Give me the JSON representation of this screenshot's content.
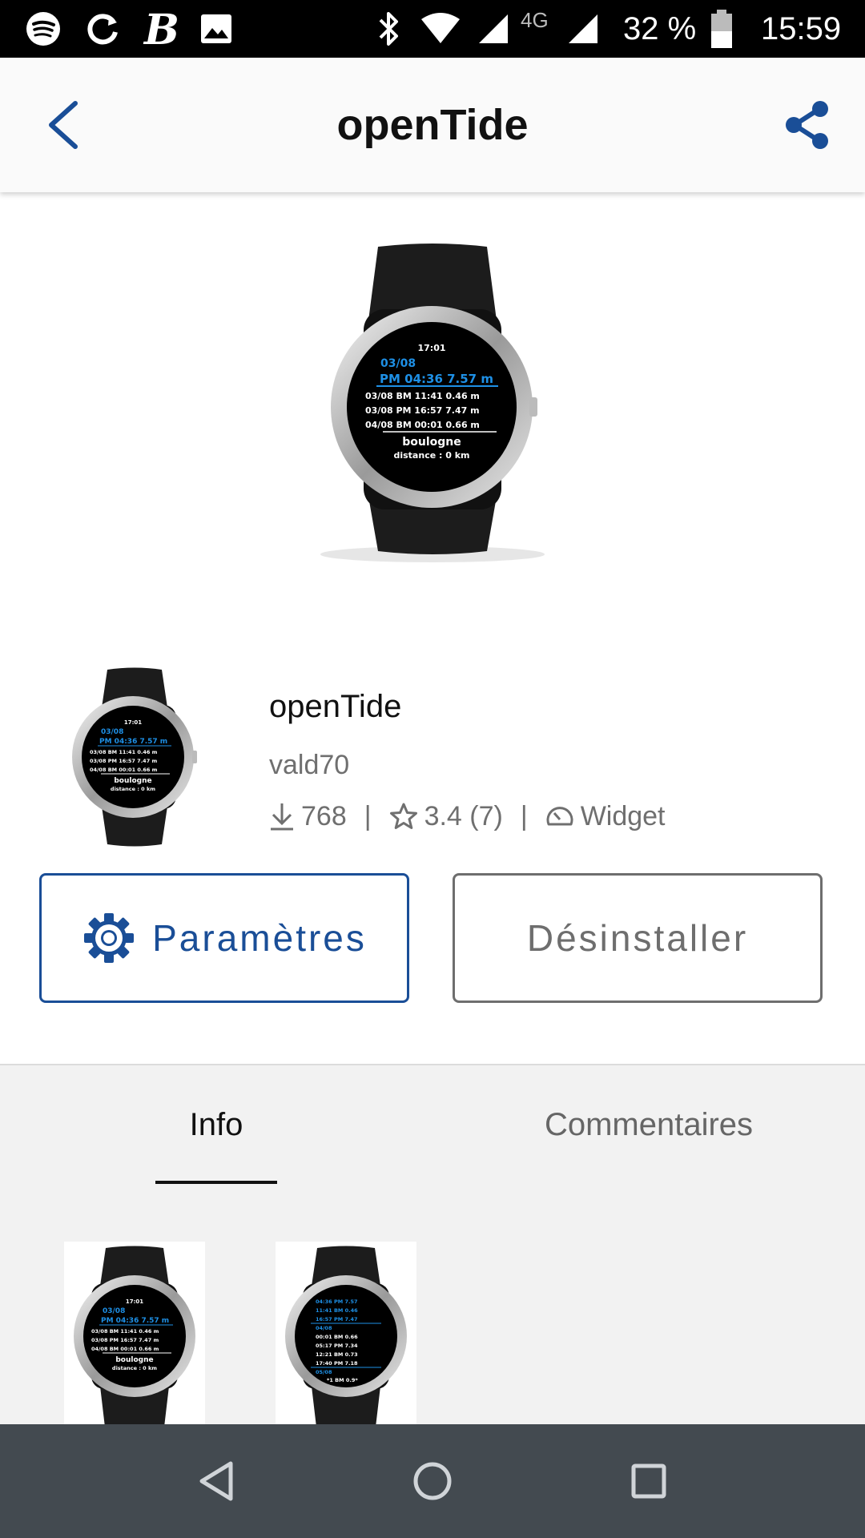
{
  "status_bar": {
    "icons": [
      "spotify-icon",
      "sync-icon",
      "b-app-icon",
      "image-icon",
      "bluetooth-icon",
      "wifi-icon",
      "signal-icon",
      "signal-4g-icon",
      "battery-icon"
    ],
    "network_label": "4G",
    "battery": "32 %",
    "time": "15:59"
  },
  "app_bar": {
    "title": "openTide",
    "back_icon": "chevron-left-icon",
    "share_icon": "share-icon"
  },
  "watch_face": {
    "time": "17:01",
    "date": "03/08",
    "highlight": "PM 04:36 7.57 m",
    "rows": [
      "03/08 BM 11:41 0.46 m",
      "03/08 PM 16:57 7.47 m",
      "04/08 BM 00:01 0.66 m"
    ],
    "place": "boulogne",
    "distance": "distance : 0 km"
  },
  "watch_face_2": {
    "rows_blue": [
      "04:36 PM 7.57",
      "11:41 BM 0.46",
      "16:57 PM 7.47"
    ],
    "date_blue": "04/08",
    "rows": [
      "00:01 BM 0.66",
      "05:17 PM 7.34",
      "12:21 BM 0.73",
      "17:40 PM 7.18"
    ],
    "date_blue_2": "05/08",
    "last": "*1 BM 0.9*"
  },
  "app_info": {
    "name": "openTide",
    "developer": "vald70",
    "downloads": "768",
    "rating": "3.4 (7)",
    "type": "Widget",
    "separator": "|"
  },
  "buttons": {
    "settings": "Paramètres",
    "uninstall": "Désinstaller"
  },
  "tabs": [
    {
      "label": "Info",
      "active": true
    },
    {
      "label": "Commentaires",
      "active": false
    }
  ],
  "colors": {
    "accent": "#1a4e97",
    "watch_blue": "#1e90e6",
    "nav_bar": "#434a50",
    "status_bar": "#000000"
  }
}
